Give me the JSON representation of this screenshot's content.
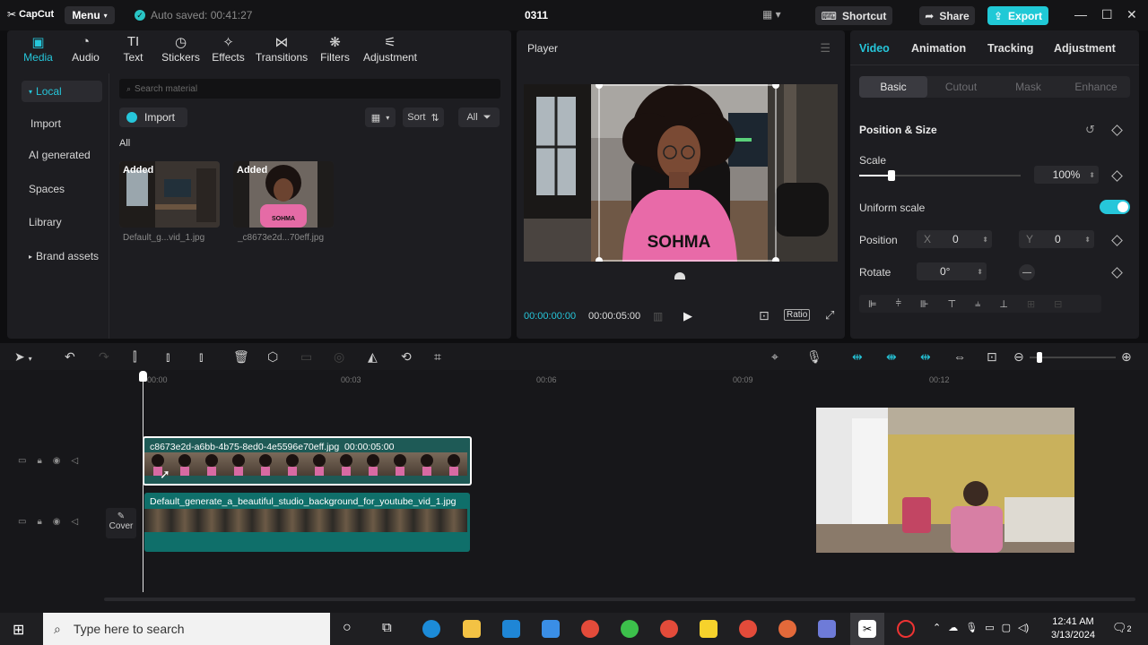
{
  "app": {
    "logo": "CapCut",
    "menu_label": "Menu",
    "autosave_text": "Auto saved: 00:41:27",
    "project_title": "0311"
  },
  "header": {
    "shortcut_label": "Shortcut",
    "share_label": "Share",
    "export_label": "Export"
  },
  "tool_tabs": [
    {
      "label": "Media",
      "icon": "media-icon"
    },
    {
      "label": "Audio",
      "icon": "audio-icon"
    },
    {
      "label": "Text",
      "icon": "text-icon"
    },
    {
      "label": "Stickers",
      "icon": "stickers-icon"
    },
    {
      "label": "Effects",
      "icon": "effects-icon"
    },
    {
      "label": "Transitions",
      "icon": "transitions-icon"
    },
    {
      "label": "Filters",
      "icon": "filters-icon"
    },
    {
      "label": "Adjustment",
      "icon": "adjustment-icon"
    }
  ],
  "sidebar": {
    "items": [
      "Local",
      "Import",
      "AI generated",
      "Spaces",
      "Library",
      "Brand assets"
    ]
  },
  "media": {
    "search_placeholder": "Search material",
    "import_label": "Import",
    "sort_label": "Sort",
    "filter_label": "All",
    "all_label": "All",
    "items": [
      {
        "badge": "Added",
        "name": "Default_g...vid_1.jpg"
      },
      {
        "badge": "Added",
        "name": "_c8673e2d...70eff.jpg"
      }
    ]
  },
  "player": {
    "title": "Player",
    "current_time": "00:00:00:00",
    "duration": "00:00:05:00",
    "ratio_label": "Ratio",
    "shirt_text": "SOHMA"
  },
  "inspector": {
    "tabs": [
      "Video",
      "Animation",
      "Tracking",
      "Adjustment"
    ],
    "sub_tabs": [
      "Basic",
      "Cutout",
      "Mask",
      "Enhance"
    ],
    "section_title": "Position & Size",
    "scale_label": "Scale",
    "scale_value": "100%",
    "scale_fraction": 0.2,
    "uniform_scale_label": "Uniform scale",
    "uniform_scale_on": true,
    "position_label": "Position",
    "pos_x_label": "X",
    "pos_x": "0",
    "pos_y_label": "Y",
    "pos_y": "0",
    "rotate_label": "Rotate",
    "rotate_value": "0°"
  },
  "timeline": {
    "ruler": [
      "00:00",
      "00:03",
      "00:06",
      "00:09",
      "00:12"
    ],
    "clip_top_name": "c8673e2d-a6bb-4b75-8ed0-4e5596e70eff.jpg",
    "clip_top_duration": "00:00:05:00",
    "clip_bottom_name": "Default_generate_a_beautiful_studio_background_for_youtube_vid_1.jpg",
    "cover_label": "Cover"
  },
  "taskbar": {
    "search_placeholder": "Type here to search",
    "time": "12:41 AM",
    "date": "3/13/2024",
    "notifications": "2"
  },
  "colors": {
    "accent": "#26c6da",
    "clip_teal": "#0f6f6a",
    "panel": "#1d1d21"
  }
}
